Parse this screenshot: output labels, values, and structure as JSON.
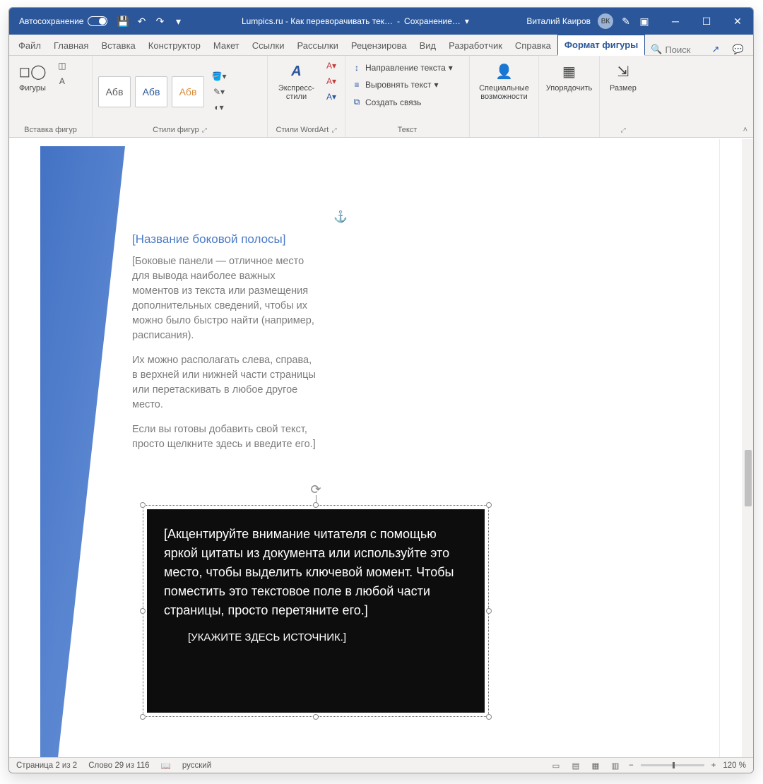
{
  "titlebar": {
    "autosave": "Автосохранение",
    "doc_title": "Lumpics.ru - Как переворачивать тек…",
    "save_status": "Сохранение…",
    "user_name": "Виталий Каиров",
    "user_initials": "ВК"
  },
  "tabs": {
    "file": "Файл",
    "home": "Главная",
    "insert": "Вставка",
    "design": "Конструктор",
    "layout": "Макет",
    "references": "Ссылки",
    "mailings": "Рассылки",
    "review": "Рецензирова",
    "view": "Вид",
    "developer": "Разработчик",
    "help": "Справка",
    "format": "Формат фигуры",
    "search": "Поиск"
  },
  "ribbon": {
    "shapes": "Фигуры",
    "insert_shapes": "Вставка фигур",
    "preset_text": "Абв",
    "shape_styles": "Стили фигур",
    "wordart": "Экспресс-стили",
    "wordart_styles": "Стили WordArt",
    "text_direction": "Направление текста",
    "align_text": "Выровнять текст",
    "create_link": "Создать связь",
    "text_group": "Текст",
    "accessibility": "Специальные возможности",
    "arrange": "Упорядочить",
    "size": "Размер"
  },
  "document": {
    "sidebar_title": "[Название боковой полосы]",
    "sidebar_p1": "[Боковые панели — отличное место для вывода наиболее важных моментов из текста или размещения дополнительных сведений, чтобы их можно было быстро найти (например, расписания).",
    "sidebar_p2": "Их можно располагать слева, справа, в верхней или нижней части страницы или перетаскивать в любое другое место.",
    "sidebar_p3": "Если вы готовы добавить свой текст, просто щелкните здесь и введите его.]",
    "quote_text": "[Акцентируйте внимание читателя с помощью яркой цитаты из документа или используйте это место, чтобы выделить ключевой момент. Чтобы поместить это текстовое поле в любой части страницы, просто перетяните его.]",
    "quote_source": "[УКАЖИТЕ ЗДЕСЬ ИСТОЧНИК.]"
  },
  "statusbar": {
    "page": "Страница 2 из 2",
    "words": "Слово 29 из 116",
    "language": "русский",
    "zoom": "120 %"
  }
}
